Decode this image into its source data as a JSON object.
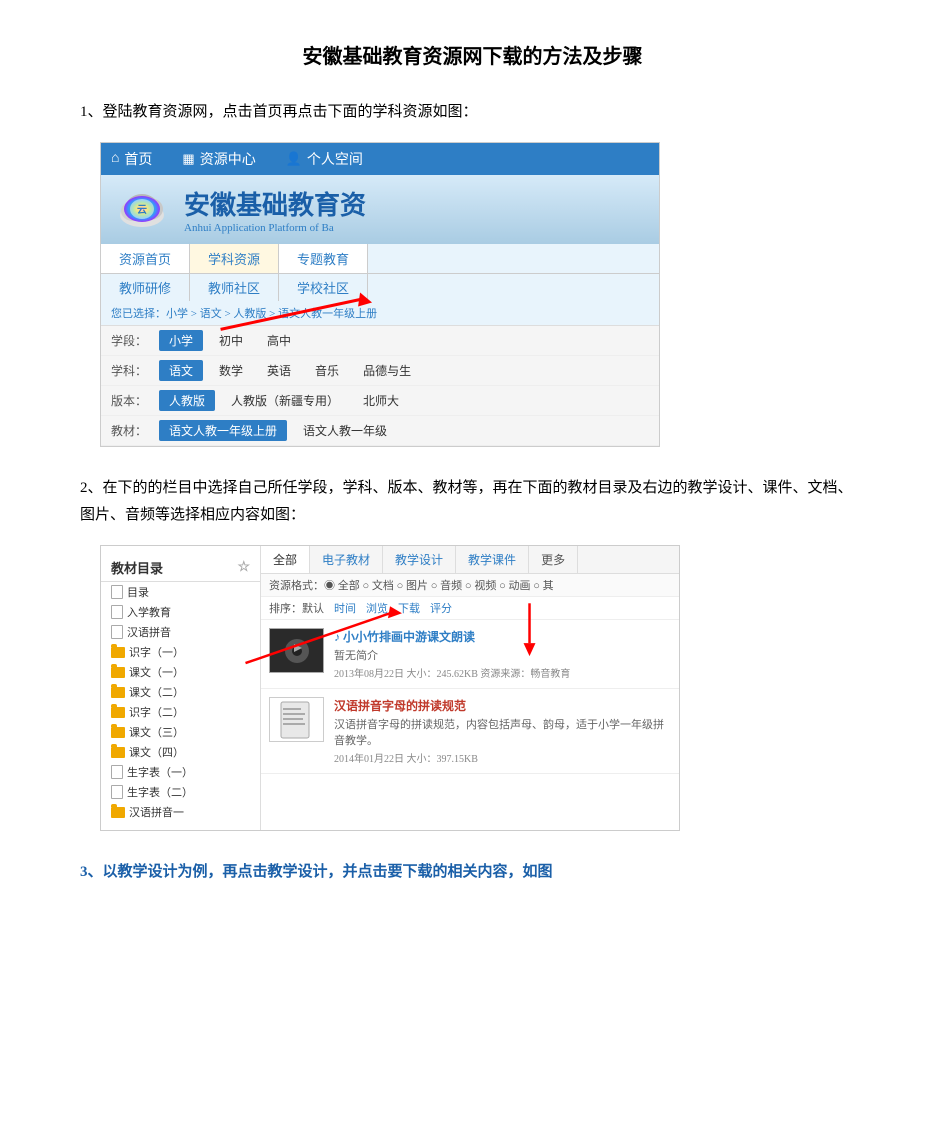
{
  "page": {
    "title": "安徽基础教育资源网下载的方法及步骤"
  },
  "steps": [
    {
      "id": "step1",
      "text": "1、登陆教育资源网，点击首页再点击下面的学科资源如图："
    },
    {
      "id": "step2",
      "text": "2、在下的的栏目中选择自己所任学段，学科、版本、教材等，再在下面的教材目录及右边的教学设计、课件、文档、图片、音频等选择相应内容如图："
    },
    {
      "id": "step3",
      "text": "3、以教学设计为例，再点击教学设计，并点击要下载的相关内容，如图"
    }
  ],
  "screenshot1": {
    "nav": {
      "items": [
        "首页",
        "资源中心",
        "个人空间"
      ]
    },
    "header": {
      "title": "安徽基础教育资",
      "subtitle": "Anhui Application Platform of Ba"
    },
    "tabs_row1": [
      "资源首页",
      "学科资源",
      "专题教育"
    ],
    "tabs_row2": [
      "教师研修",
      "教师社区",
      "学校社区"
    ],
    "breadcrumb": "您已选择：小学 > 语文 > 人教版 > 语文人教一年级上册",
    "filters": [
      {
        "label": "学段：",
        "active": "小学",
        "others": [
          "初中",
          "高中"
        ]
      },
      {
        "label": "学科：",
        "active": "语文",
        "others": [
          "数学",
          "英语",
          "音乐",
          "品德与生"
        ]
      },
      {
        "label": "版本：",
        "active": "人教版",
        "others": [
          "人教版（新疆专用）",
          "北师大"
        ]
      },
      {
        "label": "教材：",
        "active": "语文人教一年级上册",
        "others": [
          "语文人教一年级"
        ]
      }
    ]
  },
  "screenshot2": {
    "left_panel": {
      "title": "教材目录",
      "items": [
        "目录",
        "入学教育",
        "汉语拼音",
        "识字（一）",
        "课文（一）",
        "课文（二）",
        "识字（二）",
        "课文（三）",
        "课文（四）",
        "生字表（一）",
        "生字表（二）",
        "汉语拼音一"
      ]
    },
    "right_panel": {
      "tabs": [
        "全部",
        "电子教材",
        "教学设计",
        "教学课件",
        "更多"
      ],
      "filter_bar": "资源格式：◉ 全部 ○ 文档 ○ 图片 ○ 音频 ○ 视频 ○ 动画 ○ 其",
      "sort_bar": [
        "排序：默认",
        "时间",
        "浏览",
        "下载",
        "评分"
      ],
      "resources": [
        {
          "title": "小小竹排画中游课文朗读",
          "icon": "music",
          "desc": "暂无简介",
          "meta": "2013年08月22日   大小：245.62KB   资源来源：畅音教育"
        },
        {
          "title": "汉语拼音字母的拼读规范",
          "icon": "pdf",
          "desc": "汉语拼音字母的拼读规范，内容包括声母、韵母，适于小学一年级拼音教学。",
          "meta": "2014年01月22日   大小：397.15KB"
        }
      ]
    }
  }
}
